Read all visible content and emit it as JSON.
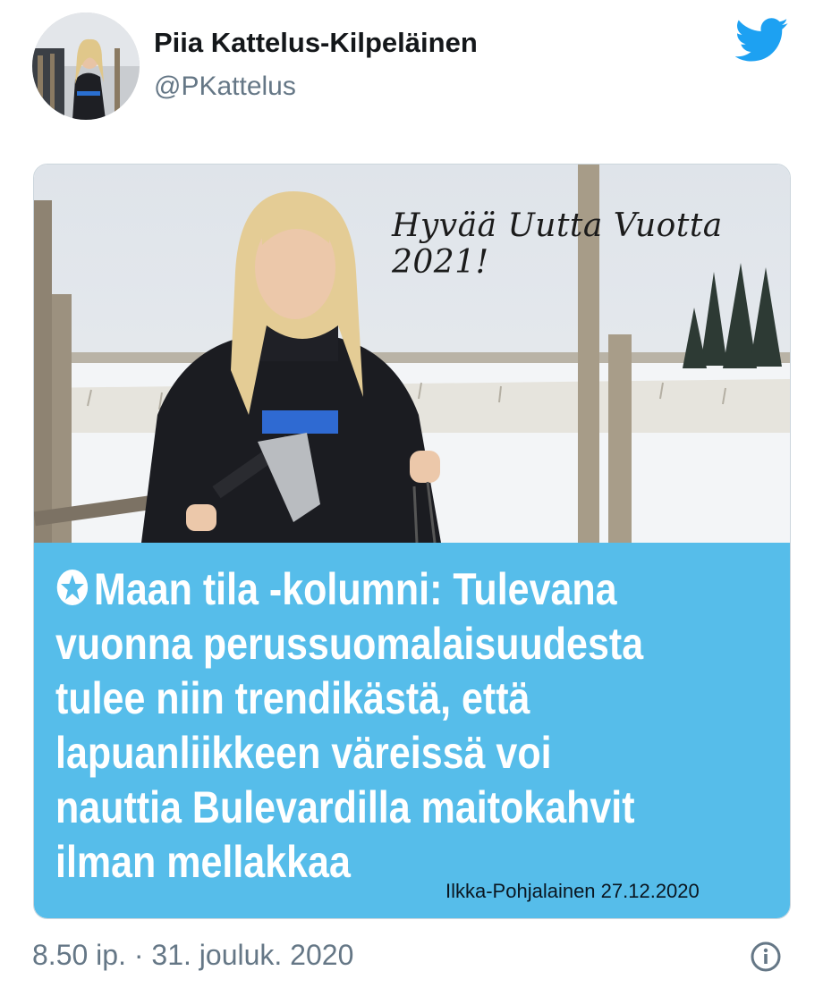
{
  "author": {
    "display_name": "Piia Kattelus-Kilpeläinen",
    "handle": "@PKattelus",
    "avatar_icon": "profile-photo"
  },
  "brand": {
    "icon": "twitter-bird-icon",
    "color": "#1da1f2"
  },
  "media": {
    "greeting": "Hyvää Uutta Vuotta 2021!",
    "headline_lines": [
      "Maan tila -kolumni: Tulevana",
      "vuonna perussuomalaisuudesta",
      "tulee niin trendikästä, että",
      "lapuanliikkeen väreissä voi",
      "nauttia Bulevardilla maitokahvit",
      "ilman mellakkaa"
    ],
    "source": "Ilkka-Pohjalainen 27.12.2020",
    "panel_color": "#56bdea"
  },
  "footer": {
    "timestamp": "8.50 ip. · 31. jouluk. 2020",
    "info_icon": "info-icon"
  }
}
